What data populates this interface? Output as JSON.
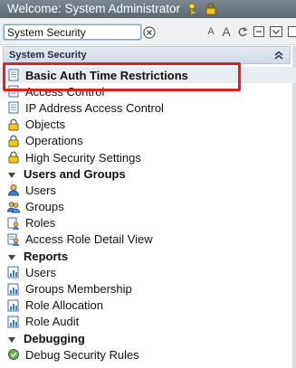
{
  "window": {
    "title": "Welcome: System Administrator"
  },
  "search": {
    "value": "System Security"
  },
  "panel": {
    "title": "System Security"
  },
  "tree": {
    "items": [
      {
        "label": "Basic Auth Time Restrictions",
        "icon": "document-icon",
        "selected": true
      },
      {
        "label": "Access Control",
        "icon": "document-icon"
      },
      {
        "label": "IP Address Access Control",
        "icon": "document-icon"
      },
      {
        "label": "Objects",
        "icon": "lock-icon"
      },
      {
        "label": "Operations",
        "icon": "lock-icon"
      },
      {
        "label": "High Security Settings",
        "icon": "lock-icon"
      }
    ],
    "sections": [
      {
        "label": "Users and Groups",
        "items": [
          {
            "label": "Users",
            "icon": "user-icon"
          },
          {
            "label": "Groups",
            "icon": "group-icon"
          },
          {
            "label": "Roles",
            "icon": "roles-icon"
          },
          {
            "label": "Access Role Detail View",
            "icon": "roles-detail-icon"
          }
        ]
      },
      {
        "label": "Reports",
        "items": [
          {
            "label": "Users",
            "icon": "report-icon"
          },
          {
            "label": "Groups Membership",
            "icon": "report-icon"
          },
          {
            "label": "Role Allocation",
            "icon": "report-icon"
          },
          {
            "label": "Role Audit",
            "icon": "report-icon"
          }
        ]
      },
      {
        "label": "Debugging",
        "items": [
          {
            "label": "Debug Security Rules",
            "icon": "debug-icon"
          }
        ]
      }
    ]
  },
  "colors": {
    "highlight": "#e3201c",
    "titlebar": "#6b757e"
  }
}
